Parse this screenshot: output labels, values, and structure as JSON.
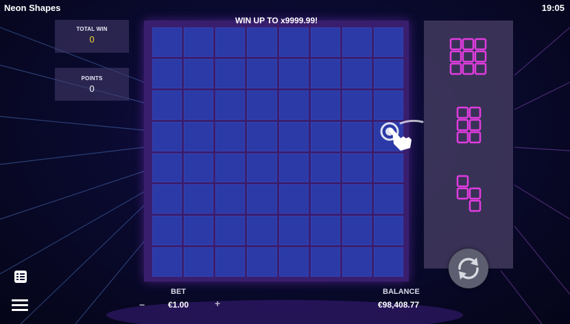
{
  "app": {
    "title": "Neon Shapes",
    "clock": "19:05"
  },
  "banner": "WIN UP TO  x9999.99!",
  "stats": {
    "total_win": {
      "label": "TOTAL WIN",
      "value": "0"
    },
    "points": {
      "label": "POINTS",
      "value": "0"
    }
  },
  "board": {
    "rows": 8,
    "cols": 8
  },
  "shapes": [
    {
      "name": "3x3 square"
    },
    {
      "name": "2x3 rectangle"
    },
    {
      "name": "S tetromino"
    }
  ],
  "footer": {
    "bet_label": "BET",
    "bet_value": "€1.00",
    "bet_minus": "−",
    "bet_plus": "+",
    "balance_label": "BALANCE",
    "balance_value": "€98,408.77"
  },
  "colors": {
    "accent_magenta": "#e23ce0",
    "cell_blue": "#2b3aa6",
    "board_purple": "#3a1e6e",
    "win_yellow": "#f4d42a"
  },
  "icons": [
    "paytable-icon",
    "menu-icon",
    "refresh-icon",
    "tap-hand-icon"
  ]
}
